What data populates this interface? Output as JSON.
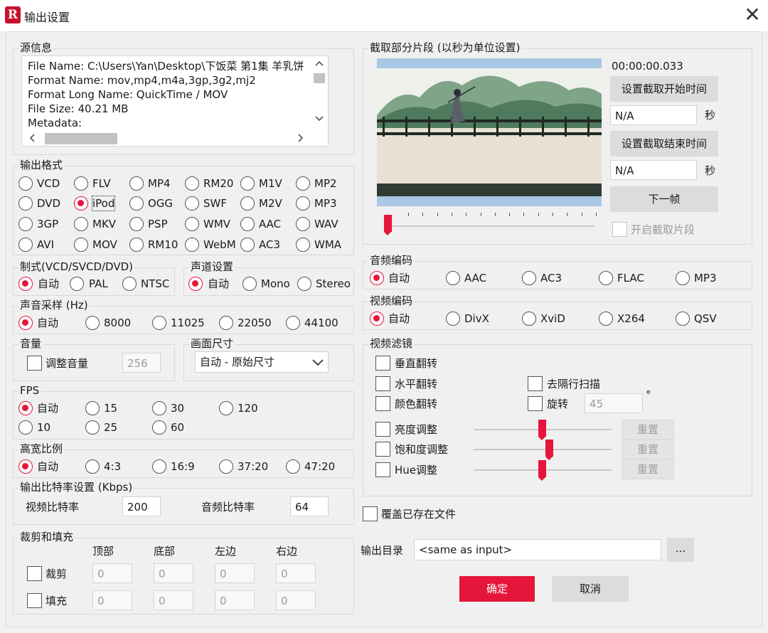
{
  "window": {
    "title": "输出设置",
    "logo": "R"
  },
  "source_info": {
    "label": "源信息",
    "lines": [
      "File Name: C:\\Users\\Yan\\Desktop\\下饭菜 第1集 羊乳饼",
      "Format Name: mov,mp4,m4a,3gp,3g2,mj2",
      "Format Long Name: QuickTime / MOV",
      "File Size: 40.21 MB",
      "Metadata:"
    ]
  },
  "output_format": {
    "label": "输出格式",
    "options": [
      "VCD",
      "FLV",
      "MP4",
      "RM20",
      "M1V",
      "MP2",
      "DVD",
      "iPod",
      "OGG",
      "SWF",
      "M2V",
      "MP3",
      "3GP",
      "MKV",
      "PSP",
      "WMV",
      "AAC",
      "WAV",
      "AVI",
      "MOV",
      "RM10",
      "WebM",
      "AC3",
      "WMA"
    ],
    "selected": "iPod"
  },
  "system": {
    "label": "制式(VCD/SVCD/DVD)",
    "options": [
      "自动",
      "PAL",
      "NTSC"
    ],
    "selected": "自动"
  },
  "channel": {
    "label": "声道设置",
    "options": [
      "自动",
      "Mono",
      "Stereo"
    ],
    "selected": "自动"
  },
  "sample_rate": {
    "label": "声音采样 (Hz)",
    "options": [
      "自动",
      "8000",
      "11025",
      "22050",
      "44100"
    ],
    "selected": "自动"
  },
  "volume": {
    "label": "音量",
    "checkbox_label": "调整音量",
    "value": "256"
  },
  "frame_size": {
    "label": "画面尺寸",
    "value": "自动 - 原始尺寸"
  },
  "fps": {
    "label": "FPS",
    "options": [
      "自动",
      "15",
      "30",
      "120",
      "10",
      "25",
      "60"
    ],
    "selected": "自动"
  },
  "aspect": {
    "label": "高宽比例",
    "options": [
      "自动",
      "4:3",
      "16:9",
      "37:20",
      "47:20"
    ],
    "selected": "自动"
  },
  "bitrate": {
    "label": "输出比特率设置 (Kbps)",
    "video_label": "视频比特率",
    "video_value": "200",
    "audio_label": "音频比特率",
    "audio_value": "64"
  },
  "crop_pad": {
    "label": "裁剪和填充",
    "headers": [
      "顶部",
      "底部",
      "左边",
      "右边"
    ],
    "rows": [
      {
        "label": "裁剪",
        "values": [
          "0",
          "0",
          "0",
          "0"
        ]
      },
      {
        "label": "填充",
        "values": [
          "0",
          "0",
          "0",
          "0"
        ]
      }
    ]
  },
  "clip": {
    "label": "截取部分片段 (以秒为单位设置)",
    "time": "00:00:00.033",
    "set_start": "设置截取开始时间",
    "start_value": "N/A",
    "set_end": "设置截取结束时间",
    "end_value": "N/A",
    "unit": "秒",
    "next_frame": "下一帧",
    "enable_label": "开启截取片段",
    "slider_position": 0
  },
  "audio_codec": {
    "label": "音频编码",
    "options": [
      "自动",
      "AAC",
      "AC3",
      "FLAC",
      "MP3"
    ],
    "selected": "自动"
  },
  "video_codec": {
    "label": "视频编码",
    "options": [
      "自动",
      "DivX",
      "XviD",
      "X264",
      "QSV"
    ],
    "selected": "自动"
  },
  "video_filter": {
    "label": "视频滤镜",
    "vflip": "垂直翻转",
    "hflip": "水平翻转",
    "color_invert": "颜色翻转",
    "deinterlace": "去隔行扫描",
    "rotate": "旋转",
    "rotate_value": "45",
    "degree": "°",
    "brightness": "亮度调整",
    "saturation": "饱和度调整",
    "hue": "Hue调整",
    "reset": "重置",
    "brightness_level": 0.5,
    "saturation_level": 0.55,
    "hue_level": 0.5
  },
  "overwrite_label": "覆盖已存在文件",
  "output_dir": {
    "label": "输出目录",
    "value": "<same as input>",
    "browse": "..."
  },
  "ok": "确定",
  "cancel": "取消"
}
